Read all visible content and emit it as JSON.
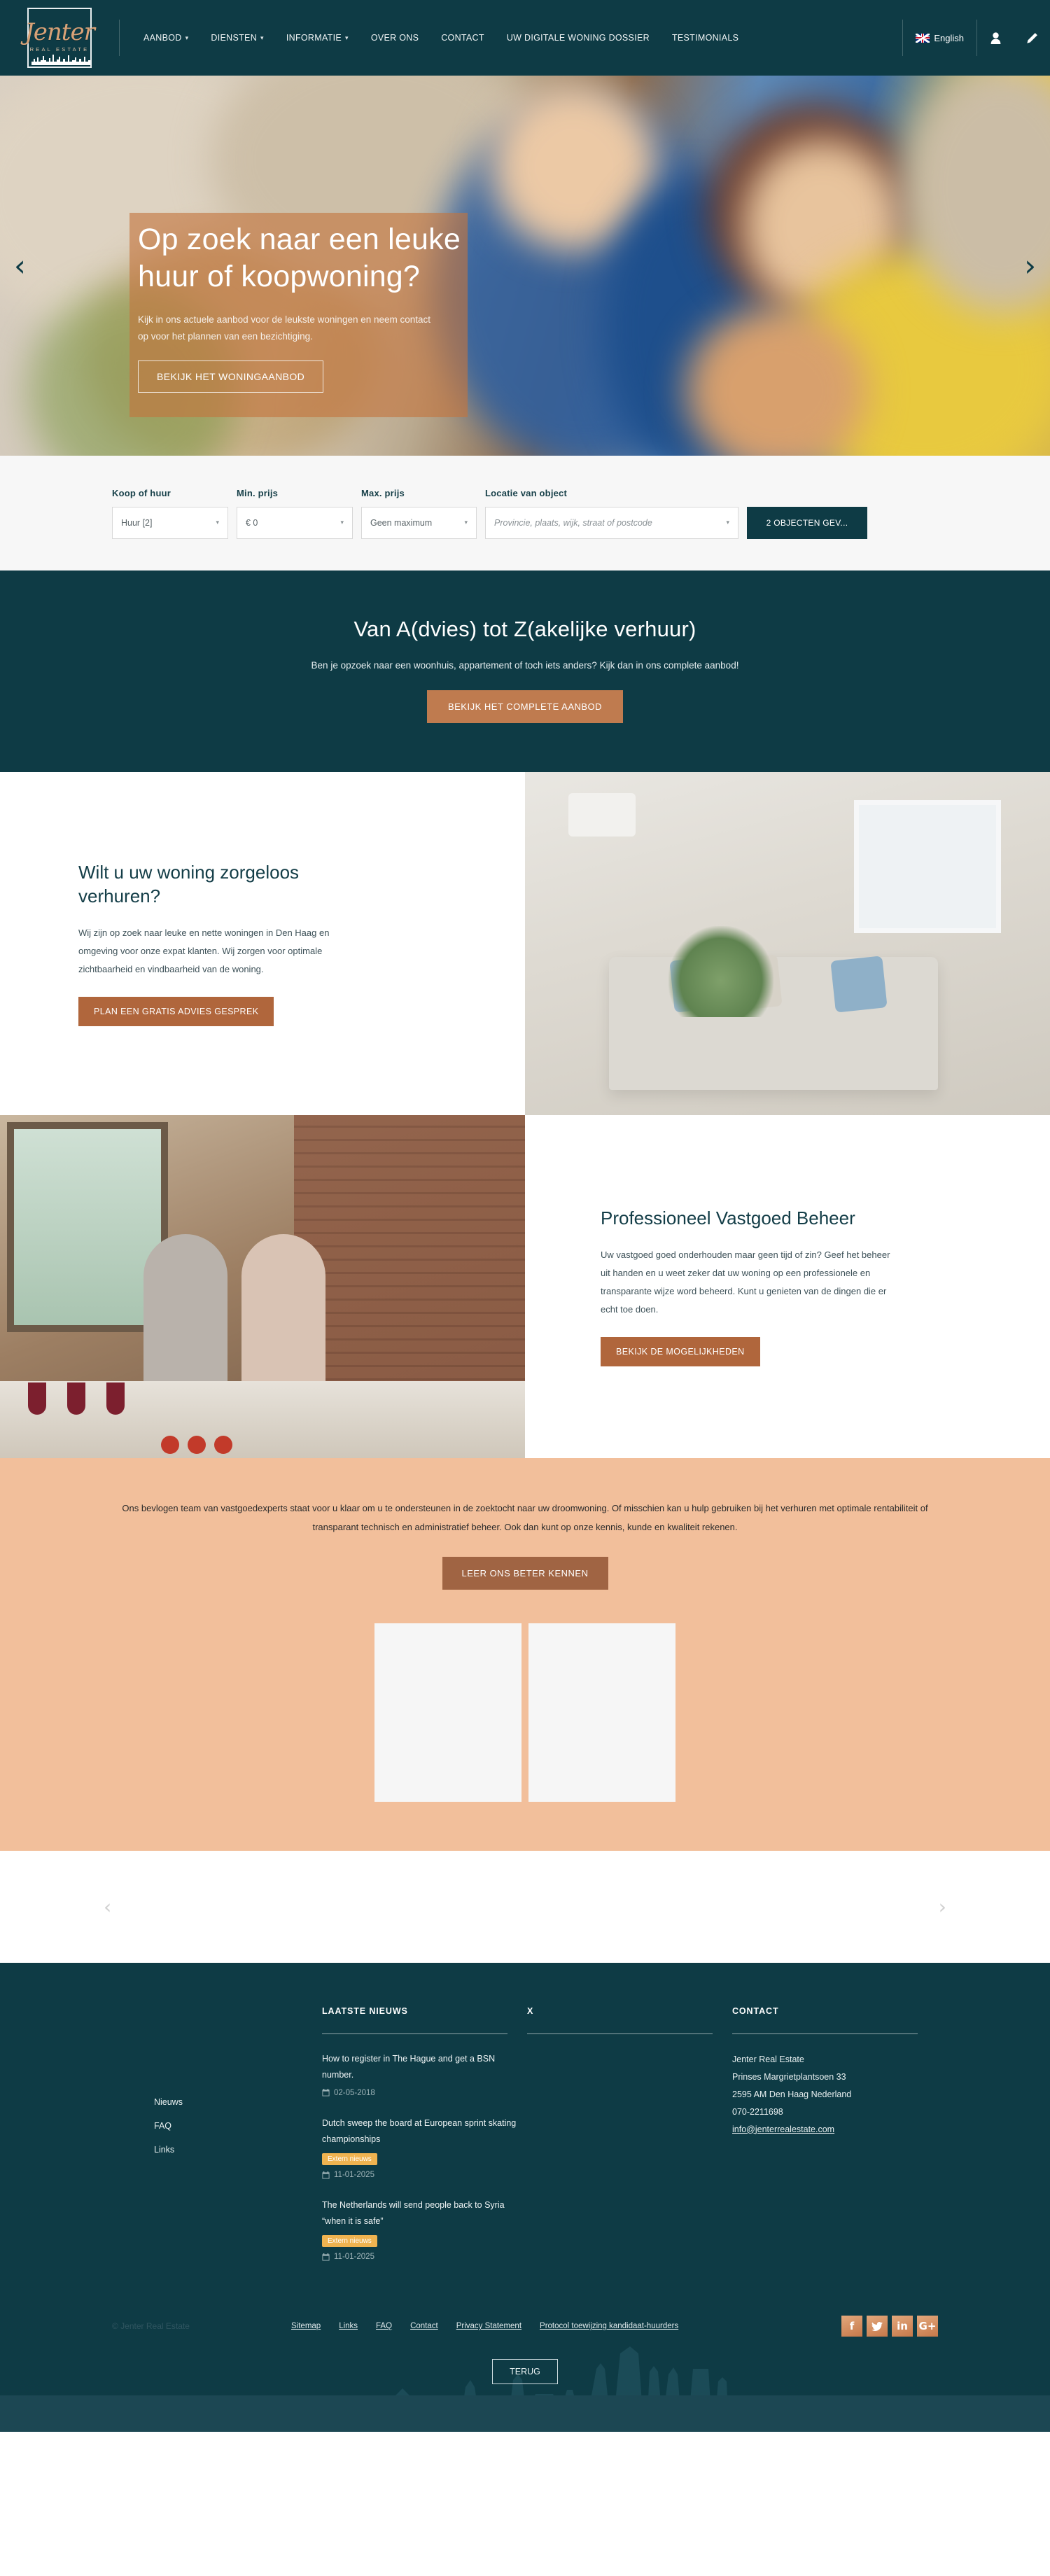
{
  "brand": {
    "logo_name": "Jenter",
    "logo_sub": "REAL ESTATE",
    "accent_copper": "#bf7b4f",
    "accent_teal": "#0e3b45",
    "accent_peach": "#f2bf9b"
  },
  "nav": {
    "items": [
      {
        "label": "AANBOD",
        "caret": "▾"
      },
      {
        "label": "DIENSTEN",
        "caret": "▾"
      },
      {
        "label": "INFORMATIE",
        "caret": "▾"
      },
      {
        "label": "OVER ONS",
        "caret": ""
      },
      {
        "label": "CONTACT",
        "caret": ""
      },
      {
        "label": "UW DIGITALE WONING DOSSIER",
        "caret": ""
      },
      {
        "label": "TESTIMONIALS",
        "caret": ""
      }
    ],
    "language": "English",
    "account_icon": "user-icon",
    "edit_icon": "pencil-icon"
  },
  "hero": {
    "title": "Op zoek naar een leuke huur of koopwoning?",
    "paragraph": "Kijk in ons actuele aanbod voor de leukste woningen en neem contact op voor het plannen van een bezichtiging.",
    "button": "BEKIJK HET WONINGAANBOD",
    "prev_icon": "chevron-left-icon",
    "next_icon": "chevron-right-icon",
    "prev_glyph": "‹",
    "next_glyph": "›"
  },
  "search": {
    "fields": [
      {
        "label": "Koop of huur",
        "value": "Huur [2]",
        "placeholder": "Koop of huur"
      },
      {
        "label": "Min. prijs",
        "value": "€ 0",
        "placeholder": "Min. prijs"
      },
      {
        "label": "Max. prijs",
        "value": "Geen maximum",
        "placeholder": "Max. prijs"
      },
      {
        "label": "Locatie van object",
        "value": "Provincie, plaats, wijk, straat of postcode",
        "placeholder": "Provincie, plaats, wijk, straat of postcode"
      }
    ],
    "submit": "2 OBJECTEN GEV...",
    "caret_glyph": "▾"
  },
  "cta_band": {
    "title": "Van A(dvies) tot Z(akelijke verhuur)",
    "subtitle": "Ben je opzoek naar een woonhuis, appartement of toch iets anders? Kijk dan in ons complete aanbod!",
    "button": "BEKIJK HET COMPLETE AANBOD"
  },
  "section_rent": {
    "title": "Wilt u uw woning zorgeloos verhuren?",
    "paragraph": "Wij zijn op zoek naar leuke en nette woningen in Den Haag en omgeving voor onze expat klanten. Wij zorgen voor optimale zichtbaarheid en vindbaarheid van de woning.",
    "button": "PLAN EEN GRATIS ADVIES GESPREK"
  },
  "section_manage": {
    "title": "Professioneel Vastgoed Beheer",
    "paragraph": "Uw vastgoed goed onderhouden maar geen tijd of zin? Geef het beheer uit handen en u weet zeker dat uw woning op een professionele en transparante wijze word beheerd. Kunt u genieten van de dingen die er echt toe doen.",
    "button": "BEKIJK DE MOGELIJKHEDEN"
  },
  "team_band": {
    "paragraph": "Ons bevlogen team van vastgoedexperts staat voor u klaar om u te ondersteunen in de zoektocht naar uw droomwoning. Of misschien kan u hulp gebruiken bij het verhuren met optimale rentabiliteit of transparant technisch en administratief beheer. Ook dan kunt op onze kennis, kunde en kwaliteit rekenen.",
    "button": "LEER ONS BETER KENNEN"
  },
  "carousel": {
    "prev_glyph": "‹",
    "next_glyph": "›"
  },
  "footer": {
    "quicklinks": [
      {
        "label": "Nieuws"
      },
      {
        "label": "FAQ"
      },
      {
        "label": "Links"
      }
    ],
    "news": {
      "title": "LAATSTE NIEUWS",
      "items": [
        {
          "title": "How to register in The Hague and get a BSN number.",
          "badge": "",
          "date": "02-05-2018"
        },
        {
          "title": "Dutch sweep the board at European sprint skating championships",
          "badge": "Extern nieuws",
          "date": "11-01-2025"
        },
        {
          "title": "The Netherlands will send people back to Syria “when it is safe”",
          "badge": "Extern nieuws",
          "date": "11-01-2025"
        }
      ]
    },
    "x_col": {
      "title": "X"
    },
    "contact": {
      "title": "CONTACT",
      "company": "Jenter Real Estate",
      "street": "Prinses Margrietplantsoen 33",
      "city": "2595 AM Den Haag Nederland",
      "phone": "070-2211698",
      "email": "info@jenterrealestate.com"
    },
    "copyright": "© Jenter Real Estate",
    "bottom_links": [
      {
        "label": "Sitemap"
      },
      {
        "label": "Links"
      },
      {
        "label": "FAQ"
      },
      {
        "label": "Contact"
      },
      {
        "label": "Privacy Statement"
      },
      {
        "label": "Protocol toewijzing kandidaat-huurders"
      }
    ],
    "social": [
      {
        "name": "facebook-icon",
        "glyph": "f"
      },
      {
        "name": "twitter-icon",
        "glyph": ""
      },
      {
        "name": "linkedin-icon",
        "glyph": "in"
      },
      {
        "name": "googleplus-icon",
        "glyph": "G+"
      }
    ],
    "back_button": "TERUG",
    "calendar_glyph": "Ὄ5"
  }
}
